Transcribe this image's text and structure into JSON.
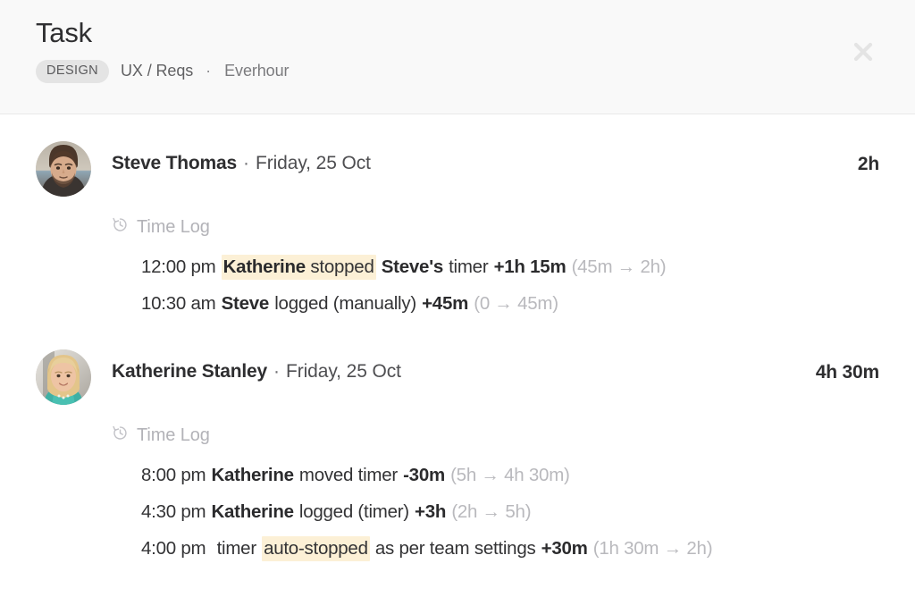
{
  "header": {
    "title": "Task",
    "badge": "DESIGN",
    "breadcrumb_path": "UX / Reqs",
    "breadcrumb_separator": "·",
    "breadcrumb_source": "Everhour",
    "close_icon": "close-icon"
  },
  "entries": [
    {
      "avatar": "avatar-steve-thomas",
      "name": "Steve Thomas",
      "separator": "·",
      "date": "Friday, 25 Oct",
      "total": "2h",
      "section_icon": "history-icon",
      "section_label": "Time Log",
      "logs": [
        {
          "time": "12:00 pm",
          "highlight_bold": "Katherine",
          "highlight_normal": "stopped",
          "actor_bold": "Steve's",
          "action": "timer",
          "delta": "+1h 15m",
          "from": "45m",
          "arrow": "→",
          "to": "2h"
        },
        {
          "time": "10:30 am",
          "actor_bold": "Steve",
          "action": "logged (manually)",
          "delta": "+45m",
          "from": "0",
          "arrow": "→",
          "to": "45m"
        }
      ]
    },
    {
      "avatar": "avatar-katherine-stanley",
      "name": "Katherine Stanley",
      "separator": "·",
      "date": "Friday, 25 Oct",
      "total": "4h 30m",
      "section_icon": "history-icon",
      "section_label": "Time Log",
      "logs": [
        {
          "time": "8:00 pm",
          "actor_bold": "Katherine",
          "action": "moved timer",
          "delta": "-30m",
          "from": "5h",
          "arrow": "→",
          "to": "4h 30m"
        },
        {
          "time": "4:30 pm",
          "actor_bold": "Katherine",
          "action": "logged (timer)",
          "delta": "+3h",
          "from": "2h",
          "arrow": "→",
          "to": "5h"
        },
        {
          "time": "4:00 pm",
          "prefix": "timer",
          "highlight_normal": "auto-stopped",
          "action": "as per team settings",
          "delta": "+30m",
          "from": "1h 30m",
          "arrow": "→",
          "to": "2h"
        }
      ]
    }
  ],
  "colors": {
    "header_bg": "#f9f9f9",
    "body_bg": "#ffffff",
    "badge_bg": "#e4e4e4",
    "highlight": "#fcf0d6",
    "muted_text": "#b9b9bd",
    "primary_text": "#2e2e30"
  }
}
